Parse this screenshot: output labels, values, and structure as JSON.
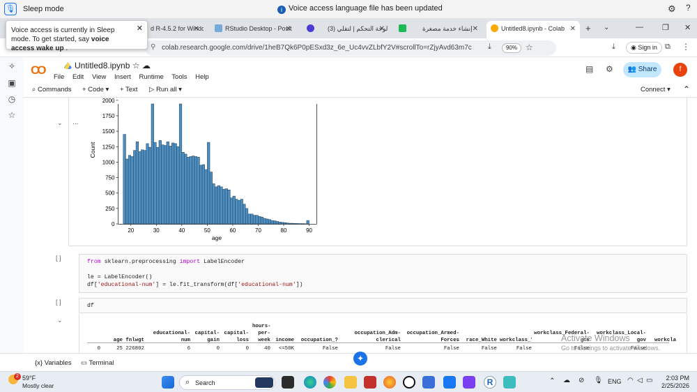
{
  "voice": {
    "mode": "Sleep mode",
    "notice": "Voice access language file has been updated",
    "popup_text_1": "Voice access is currently in Sleep mode. To get started, say ",
    "popup_cmd": "voice access wake up",
    "popup_end": " ."
  },
  "tabs": [
    {
      "label": "d R-4.5.2 for Windc"
    },
    {
      "label": "RStudio Desktop - Posit"
    },
    {
      "label": ""
    },
    {
      "label": "(3) لوحة التحكم | لتقلي"
    },
    {
      "label": ""
    },
    {
      "label": "إنشاء خدمة مصغرة"
    },
    {
      "label": "Untitled8.ipynb - Colab"
    }
  ],
  "browser": {
    "url": "colab.research.google.com/drive/1heB7Qk6P0pESxd3z_6e_Uc4vvZLbfY2V#scrollTo=rZjyAvd63m7c",
    "zoom": "90%",
    "signin": "Sign in"
  },
  "colab": {
    "logo": "CO",
    "title": "Untitled8.ipynb",
    "menu": [
      "File",
      "Edit",
      "View",
      "Insert",
      "Runtime",
      "Tools",
      "Help"
    ],
    "share": "Share",
    "avatar": "f",
    "toolbar": {
      "commands": "Commands",
      "code": "+ Code",
      "text": "+ Text",
      "runall": "Run all",
      "connect": "Connect"
    }
  },
  "chart_data": {
    "type": "bar",
    "title": "",
    "xlabel": "age",
    "ylabel": "Count",
    "xlim": [
      15,
      93
    ],
    "ylim": [
      0,
      2100
    ],
    "xticks": [
      20,
      30,
      40,
      50,
      60,
      70,
      80,
      90
    ],
    "yticks": [
      0,
      250,
      500,
      750,
      1000,
      1250,
      1500,
      1750,
      2000
    ],
    "bin_start": 17,
    "bin_width": 1,
    "values": [
      1450,
      1050,
      1110,
      1090,
      1190,
      1330,
      1170,
      1200,
      1190,
      1300,
      1240,
      2100,
      1320,
      1240,
      1350,
      1280,
      1270,
      1330,
      1260,
      1310,
      1300,
      1250,
      2110,
      1160,
      1130,
      1080,
      1090,
      1100,
      1090,
      1080,
      950,
      960,
      880,
      1320,
      840,
      650,
      600,
      620,
      600,
      560,
      570,
      550,
      420,
      450,
      400,
      380,
      400,
      320,
      250,
      160,
      160,
      140,
      140,
      120,
      110,
      90,
      80,
      70,
      55,
      50,
      40,
      30,
      25,
      20,
      15,
      10,
      10,
      8,
      6,
      5,
      5,
      3,
      55
    ]
  },
  "cell2": {
    "gutter": "[ ]",
    "line1_kw1": "from",
    "line1_mod": " sklearn.preprocessing ",
    "line1_kw2": "import",
    "line1_name": " LabelEncoder",
    "line2": "le = LabelEncoder()",
    "line3_a": "df[",
    "line3_s1": "'educational-num'",
    "line3_b": "] = le.fit_transform(df[",
    "line3_s2": "'educational-num'",
    "line3_c": "])"
  },
  "cell3": {
    "gutter": "[ ]",
    "code": "df",
    "columns": [
      "age",
      "fnlwgt",
      "educational-\nnum",
      "capital-\ngain",
      "capital-\nloss",
      "hours-\nper-\nweek",
      "income",
      "occupation_?",
      "occupation_Adm-\nclerical",
      "occupation_Armed-\nForces",
      "...",
      "race_White",
      "workclass_?",
      "workclass_Federal-\ngov",
      "workclass_Local-\ngov",
      "workcla"
    ],
    "row0": [
      "0",
      "25",
      "226802",
      "6",
      "0",
      "0",
      "40",
      "<=50K",
      "False",
      "False",
      "False",
      "",
      "False",
      "False",
      "False",
      "False"
    ]
  },
  "watermark": {
    "line1": "Activate Windows",
    "line2": "Go to Settings to activate Windows."
  },
  "status": {
    "variables": "Variables",
    "terminal": "Terminal"
  },
  "taskbar": {
    "temp": "59°F",
    "weather": "Mostly clear",
    "badge": "2",
    "search": "Search",
    "lang": "ENG",
    "time": "2:03 PM",
    "date": "2/25/2026"
  }
}
